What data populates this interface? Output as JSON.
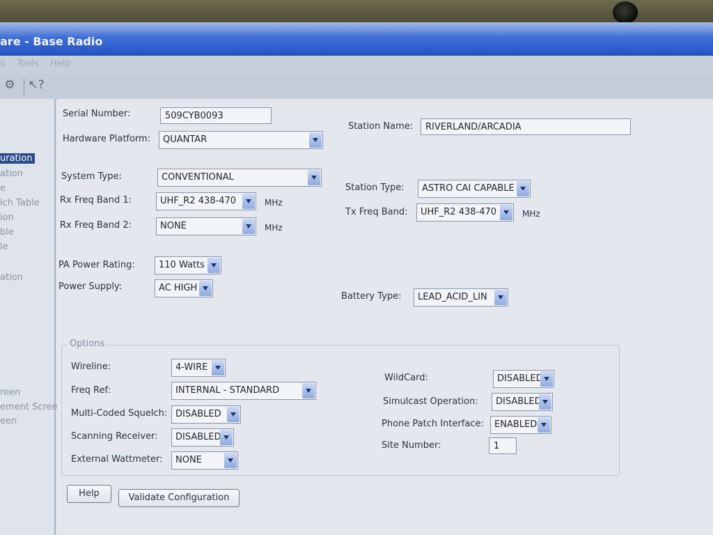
{
  "window": {
    "title": "are - Base Radio"
  },
  "menu": {
    "items": [
      "o",
      "Tools",
      "Help"
    ]
  },
  "nav": {
    "items": [
      "uration",
      "ation",
      "e",
      "lch Table",
      "ion",
      "ble",
      "le",
      "ation",
      "reen",
      "ement Scree",
      "een"
    ],
    "selected_index": 0
  },
  "form": {
    "serial_number": {
      "label": "Serial Number:",
      "value": "509CYB0093"
    },
    "station_name": {
      "label": "Station Name:",
      "value": "RIVERLAND/ARCADIA"
    },
    "hardware_platform": {
      "label": "Hardware Platform:",
      "value": "QUANTAR"
    },
    "system_type": {
      "label": "System Type:",
      "value": "CONVENTIONAL"
    },
    "station_type": {
      "label": "Station Type:",
      "value": "ASTRO CAI CAPABLE"
    },
    "rx_freq_band_1": {
      "label": "Rx Freq Band 1:",
      "value": "UHF_R2  438-470",
      "unit": "MHz"
    },
    "tx_freq_band": {
      "label": "Tx Freq Band:",
      "value": "UHF_R2  438-470",
      "unit": "MHz"
    },
    "rx_freq_band_2": {
      "label": "Rx Freq Band 2:",
      "value": "NONE",
      "unit": "MHz"
    },
    "pa_power_rating": {
      "label": "PA Power Rating:",
      "value": "110 Watts"
    },
    "power_supply": {
      "label": "Power Supply:",
      "value": "AC HIGH"
    },
    "battery_type": {
      "label": "Battery Type:",
      "value": "LEAD_ACID_LIN"
    }
  },
  "options": {
    "legend": "Options",
    "wireline": {
      "label": "Wireline:",
      "value": "4-WIRE"
    },
    "freq_ref": {
      "label": "Freq Ref:",
      "value": "INTERNAL - STANDARD"
    },
    "multi_coded_squelch": {
      "label": "Multi-Coded Squelch:",
      "value": "DISABLED"
    },
    "scanning_receiver": {
      "label": "Scanning Receiver:",
      "value": "DISABLED"
    },
    "external_wattmeter": {
      "label": "External Wattmeter:",
      "value": "NONE"
    },
    "wildcard": {
      "label": "WildCard:",
      "value": "DISABLED"
    },
    "simulcast_operation": {
      "label": "Simulcast Operation:",
      "value": "DISABLED"
    },
    "phone_patch_interface": {
      "label": "Phone Patch Interface:",
      "value": "ENABLED"
    },
    "site_number": {
      "label": "Site Number:",
      "value": "1"
    }
  },
  "buttons": {
    "help": "Help",
    "validate": "Validate Configuration"
  },
  "icons": {
    "toolbar": [
      "network-config-icon",
      "context-help-icon"
    ],
    "combo": "chevron-down-icon"
  },
  "colors": {
    "title_bar": "#2452c6",
    "nav_selected": "#2d4a8a",
    "options_legend": "#7c8ea8"
  }
}
